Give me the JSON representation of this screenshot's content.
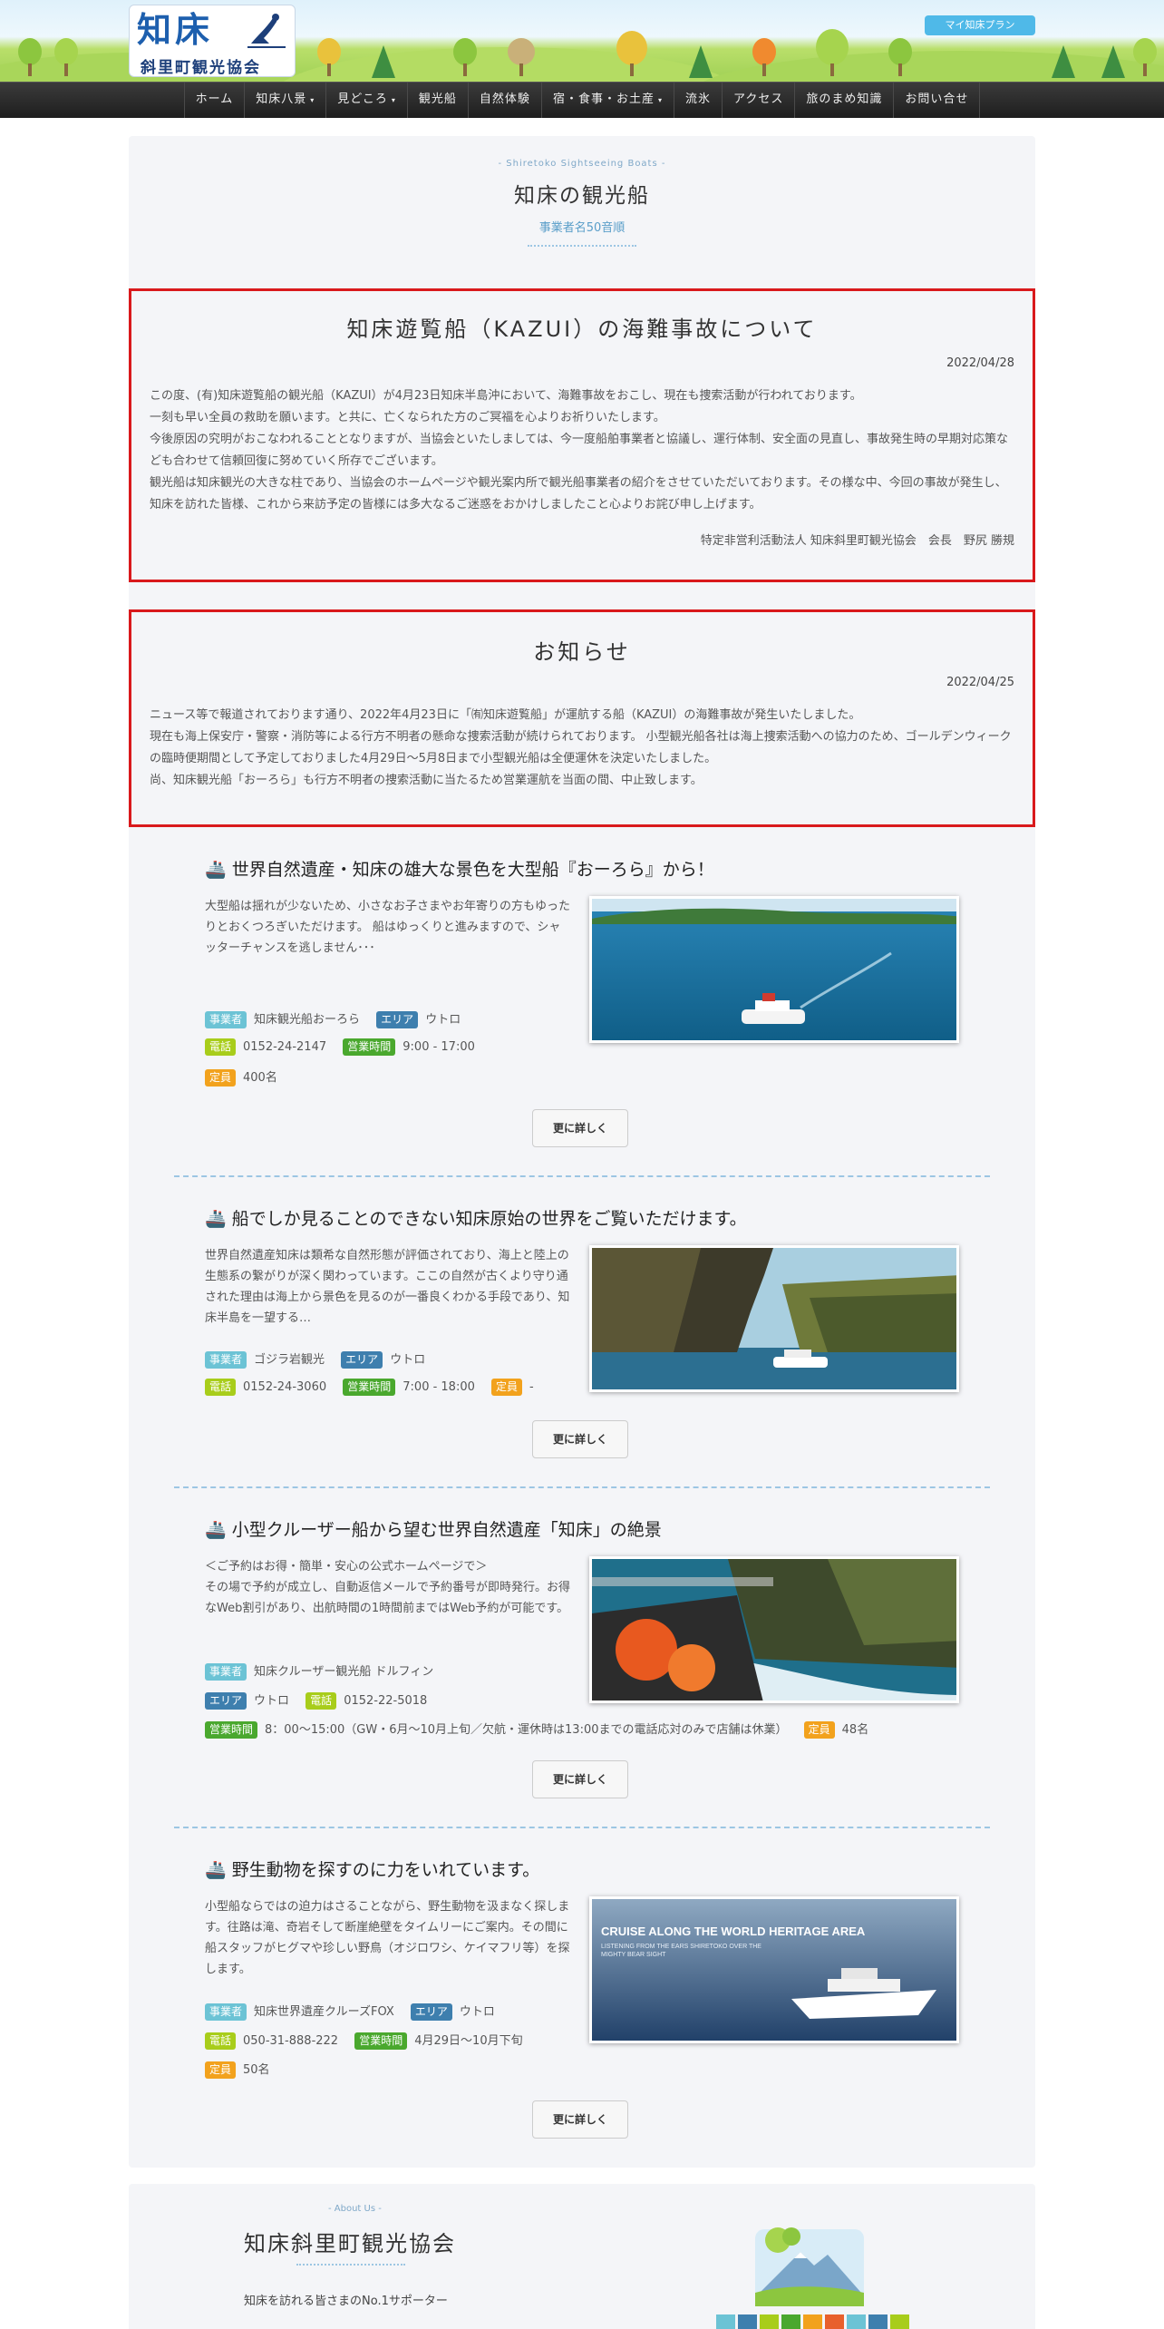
{
  "header": {
    "logo_main": "知床",
    "logo_sub": "斜里町観光協会",
    "plan_button": "マイ知床プラン"
  },
  "nav": {
    "items": [
      {
        "label": "ホーム",
        "has_menu": false
      },
      {
        "label": "知床八景",
        "has_menu": true
      },
      {
        "label": "見どころ",
        "has_menu": true
      },
      {
        "label": "観光船",
        "has_menu": false
      },
      {
        "label": "自然体験",
        "has_menu": false
      },
      {
        "label": "宿・食事・お土産",
        "has_menu": true
      },
      {
        "label": "流氷",
        "has_menu": false
      },
      {
        "label": "アクセス",
        "has_menu": false
      },
      {
        "label": "旅のまめ知識",
        "has_menu": false
      },
      {
        "label": "お問い合せ",
        "has_menu": false
      }
    ],
    "caret": "▾"
  },
  "page": {
    "eyebrow": "- Shiretoko Sightseeing Boats -",
    "title": "知床の観光船",
    "subtitle": "事業者名50音順"
  },
  "notice1": {
    "title": "知床遊覧船（KAZUⅠ）の海難事故について",
    "date": "2022/04/28",
    "paragraphs": [
      "この度、(有)知床遊覧船の観光船（KAZUⅠ）が4月23日知床半島沖において、海難事故をおこし、現在も捜索活動が行われております。",
      "一刻も早い全員の救助を願います。と共に、亡くなられた方のご冥福を心よりお祈りいたします。",
      "今後原因の究明がおこなわれることとなりますが、当協会といたしましては、今一度船舶事業者と協議し、運行体制、安全面の見直し、事故発生時の早期対応策なども合わせて信頼回復に努めていく所存でございます。",
      "観光船は知床観光の大きな柱であり、当協会のホームページや観光案内所で観光船事業者の紹介をさせていただいております。その様な中、今回の事故が発生し、知床を訪れた皆様、これから来訪予定の皆様には多大なるご迷惑をおかけしましたこと心よりお詫び申し上げます。"
    ],
    "signature": "特定非営利活動法人 知床斜里町観光協会　会長　野尻 勝規"
  },
  "notice2": {
    "title": "お知らせ",
    "date": "2022/04/25",
    "paragraphs": [
      "ニュース等で報道されております通り、2022年4月23日に「㈲知床遊覧船」が運航する船（KAZUⅠ）の海難事故が発生いたしました。",
      "現在も海上保安庁・警察・消防等による行方不明者の懸命な捜索活動が続けられております。 小型観光船各社は海上捜索活動への協力のため、ゴールデンウィークの臨時便期間として予定しておりました4月29日～5月8日まで小型観光船は全便運休を決定いたしました。",
      "尚、知床観光船「おーろら」も行方不明者の捜索活動に当たるため営業運航を当面の間、中止致します。"
    ]
  },
  "labels": {
    "business": "事業者",
    "area": "エリア",
    "phone": "電話",
    "hours": "営業時間",
    "capacity": "定員",
    "more": "更に詳しく"
  },
  "entries": [
    {
      "title": "🚢 世界自然遺産・知床の雄大な景色を大型船『おーろら』から！",
      "desc": "大型船は揺れが少ないため、小さなお子さまやお年寄りの方もゆったりとおくつろぎいただけます。 船はゆっくりと進みますので、シャッターチャンスを逃しません･･･",
      "business": "知床観光船おーろら",
      "area": "ウトロ",
      "phone": "0152-24-2147",
      "hours": "9:00 - 17:00",
      "capacity": "400名"
    },
    {
      "title": "🚢 船でしか見ることのできない知床原始の世界をご覧いただけます。",
      "desc": "世界自然遺産知床は類希な自然形態が評価されており、海上と陸上の生態系の繋がりが深く関わっています。ここの自然が古くより守り通された理由は海上から景色を見るのが一番良くわかる手段であり、知床半島を一望する…",
      "business": "ゴジラ岩観光",
      "area": "ウトロ",
      "phone": "0152-24-3060",
      "hours": "7:00 - 18:00",
      "capacity": "-"
    },
    {
      "title": "🚢 小型クルーザー船から望む世界自然遺産「知床」の絶景",
      "desc": "＜ご予約はお得・簡単・安心の公式ホームページで＞\nその場で予約が成立し、自動返信メールで予約番号が即時発行。お得なWeb割引があり、出航時間の1時間前まではWeb予約が可能です。",
      "business": "知床クルーザー観光船 ドルフィン",
      "area": "ウトロ",
      "phone": "0152-22-5018",
      "hours": "8：00～15:00（GW・6月～10月上旬／欠航・運休時は13:00までの電話応対のみで店舗は休業）",
      "capacity": "48名"
    },
    {
      "title": "🚢 野生動物を探すのに力をいれています。",
      "desc": "小型船ならではの迫力はさることながら、野生動物を汲まなく探します。往路は滝、奇岩そして断崖絶壁をタイムリーにご案内。その間に船スタッフがヒグマや珍しい野鳥（オジロワシ、ケイマフリ等）を探します。",
      "business": "知床世界遺産クルーズFOX",
      "area": "ウトロ",
      "phone": "050-31-888-222",
      "hours": "4月29日～10月下旬",
      "capacity": "50名",
      "img_caption": "CRUISE ALONG THE WORLD HERITAGE AREA",
      "img_caption2": "LISTENING FROM THE EARS SHIRETOKO OVER THE MIGHTY BEAR SIGHT"
    }
  ],
  "about": {
    "eyebrow": "- About Us -",
    "title": "知床斜里町観光協会",
    "text": "知床を訪れる皆さまのNo.1サポーター"
  },
  "colors": {
    "accent": "#5a9ec9",
    "notice_border": "#d9191c",
    "nav_bg": "#2b2b2b",
    "strip": [
      "#6cc3d5",
      "#3e7fae",
      "#a8cd1b",
      "#4aa82e",
      "#f2a21d",
      "#e8602c",
      "#6cc3d5",
      "#3e7fae",
      "#a8cd1b"
    ]
  }
}
